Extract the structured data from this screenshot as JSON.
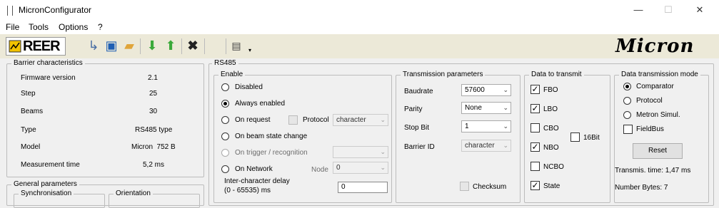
{
  "window": {
    "title": "MicronConfigurator",
    "min": "—",
    "max": "☐",
    "close": "✕"
  },
  "menu": [
    "File",
    "Tools",
    "Options",
    "?"
  ],
  "toolbar": {
    "reer_logo": "REER",
    "micron_logo": "Micron"
  },
  "barrier": {
    "legend": "Barrier characteristics",
    "rows": [
      {
        "label": "Firmware version",
        "value": "2.1"
      },
      {
        "label": "Step",
        "value": "25"
      },
      {
        "label": "Beams",
        "value": "30"
      },
      {
        "label": "Type",
        "value": "RS485 type"
      },
      {
        "label": "Model",
        "value": "Micron  752 B"
      },
      {
        "label": "Measurement time",
        "value": "5,2 ms"
      }
    ]
  },
  "general": {
    "legend": "General parameters",
    "sync": "Synchronisation",
    "orient": "Orientation"
  },
  "rs485": {
    "legend": "RS485",
    "enable": {
      "legend": "Enable",
      "disabled": "Disabled",
      "always": "Always enabled",
      "on_request": "On request",
      "protocol": "Protocol",
      "protocol_value": "character",
      "on_beam": "On beam state change",
      "on_trigger": "On trigger / recognition",
      "trigger_value": "",
      "on_network": "On Network",
      "node": "Node",
      "node_value": "0",
      "delay1": "Inter-character delay",
      "delay2": "(0 - 65535) ms",
      "delay_value": "0"
    },
    "tx": {
      "legend": "Transmission parameters",
      "baud_label": "Baudrate",
      "baud_value": "57600",
      "parity_label": "Parity",
      "parity_value": "None",
      "stop_label": "Stop Bit",
      "stop_value": "1",
      "id_label": "Barrier ID",
      "id_value": "character",
      "checksum": "Checksum"
    },
    "data": {
      "legend": "Data to transmit",
      "fbo": "FBO",
      "lbo": "LBO",
      "cbo": "CBO",
      "nbo": "NBO",
      "ncbo": "NCBO",
      "state": "State",
      "bit16": "16Bit"
    },
    "mode": {
      "legend": "Data transmission mode",
      "comparator": "Comparator",
      "protocol": "Protocol",
      "metron": "Metron Simul.",
      "fieldbus": "FieldBus",
      "reset": "Reset",
      "time": "Transmis. time: 1,47 ms",
      "bytes": "Number Bytes: 7"
    }
  }
}
